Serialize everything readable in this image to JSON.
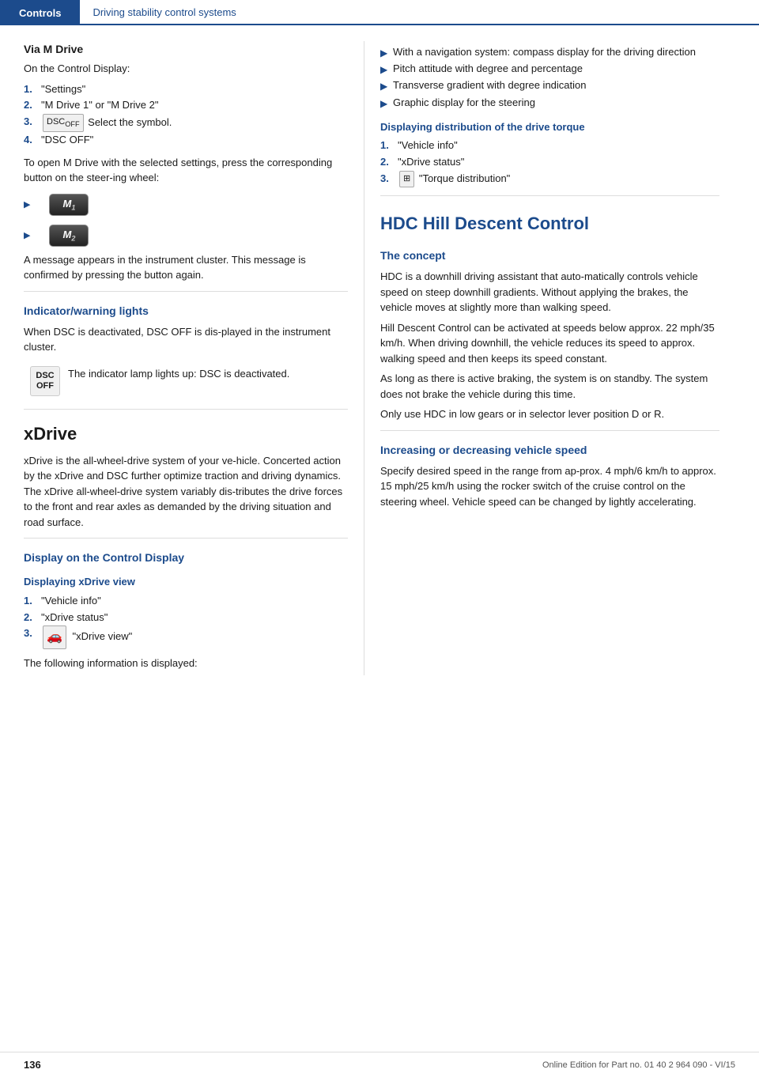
{
  "header": {
    "controls_label": "Controls",
    "section_label": "Driving stability control systems"
  },
  "left": {
    "via_m_drive": {
      "heading": "Via M Drive",
      "subtitle": "On the Control Display:",
      "steps": [
        {
          "num": "1.",
          "text": "\"Settings\""
        },
        {
          "num": "2.",
          "text": "\"M Drive 1\" or \"M Drive 2\""
        },
        {
          "num": "3.",
          "text": "Select the symbol.",
          "icon": true
        },
        {
          "num": "4.",
          "text": "\"DSC OFF\""
        }
      ],
      "m_drive_text": "To open M Drive with the selected settings, press the corresponding button on the steer-ing wheel:",
      "m_buttons": [
        {
          "label": "M",
          "sub": "1"
        },
        {
          "label": "M",
          "sub": "2"
        }
      ],
      "after_text": "A message appears in the instrument cluster. This message is confirmed by pressing the button again."
    },
    "indicator": {
      "heading": "Indicator/warning lights",
      "text": "When DSC is deactivated, DSC OFF is dis-played in the instrument cluster.",
      "warning_text": "The indicator lamp lights up: DSC is deactivated."
    },
    "xdrive": {
      "heading": "xDrive",
      "text": "xDrive is the all-wheel-drive system of your ve-hicle. Concerted action by the xDrive and DSC further optimize traction and driving dynamics. The xDrive all-wheel-drive system variably dis-tributes the drive forces to the front and rear axles as demanded by the driving situation and road surface."
    },
    "display_control": {
      "heading": "Display on the Control Display",
      "subheading_xdrive_view": "Displaying xDrive view",
      "steps": [
        {
          "num": "1.",
          "text": "\"Vehicle info\""
        },
        {
          "num": "2.",
          "text": "\"xDrive status\""
        },
        {
          "num": "3.",
          "text": "\"xDrive view\"",
          "icon": "car"
        }
      ],
      "following_text": "The following information is displayed:"
    }
  },
  "right": {
    "bullet_items": [
      "With a navigation system: compass display for the driving direction",
      "Pitch attitude with degree and percentage",
      "Transverse gradient with degree indication",
      "Graphic display for the steering"
    ],
    "torque_section": {
      "heading": "Displaying distribution of the drive torque",
      "steps": [
        {
          "num": "1.",
          "text": "\"Vehicle info\""
        },
        {
          "num": "2.",
          "text": "\"xDrive status\""
        },
        {
          "num": "3.",
          "text": "\"Torque distribution\"",
          "icon": "torque"
        }
      ]
    },
    "hdc": {
      "big_heading": "HDC Hill Descent Control",
      "concept": {
        "heading": "The concept",
        "paragraphs": [
          "HDC is a downhill driving assistant that auto-matically controls vehicle speed on steep downhill gradients. Without applying the brakes, the vehicle moves at slightly more than walking speed.",
          "Hill Descent Control can be activated at speeds below approx. 22 mph/35 km/h. When driving downhill, the vehicle reduces its speed to approx. walking speed and then keeps its speed constant.",
          "As long as there is active braking, the system is on standby. The system does not brake the vehicle during this time.",
          "Only use HDC in low gears or in selector lever position D or R."
        ]
      },
      "increasing": {
        "heading": "Increasing or decreasing vehicle speed",
        "text": "Specify desired speed in the range from ap-prox. 4 mph/6 km/h to approx. 15 mph/25 km/h using the rocker switch of the cruise control on the steering wheel. Vehicle speed can be changed by lightly accelerating."
      }
    }
  },
  "footer": {
    "page": "136",
    "info": "Online Edition for Part no. 01 40 2 964 090 - VI/15"
  }
}
